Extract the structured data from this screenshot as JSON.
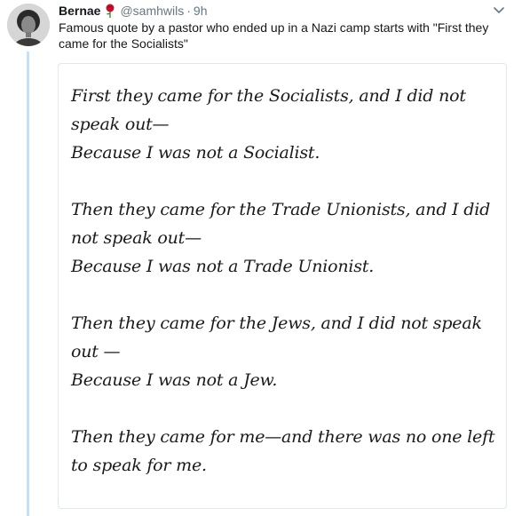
{
  "tweet": {
    "display_name": "Bernae",
    "handle": "@samhwils",
    "separator": "·",
    "time": "9h",
    "text": "Famous quote by a pastor who ended up in a Nazi camp starts with \"First they came for the Socialists\""
  },
  "icons": {
    "name_emoji": "rose-icon",
    "menu": "chevron-down-icon",
    "avatar": "avatar-photo"
  },
  "colors": {
    "thread_line": "#c4dff6",
    "secondary_text": "#657786",
    "card_border": "#e1e8ed"
  },
  "quote": {
    "stanzas": [
      {
        "lines": [
          "First they came for the Socialists, and I did not speak out—",
          "Because I was not a Socialist."
        ]
      },
      {
        "lines": [
          "Then they came for the Trade Unionists, and I did not speak out—",
          "Because I was not a Trade Unionist."
        ]
      },
      {
        "lines": [
          "Then they came for the Jews, and I did not speak out —",
          "Because I was not a Jew."
        ]
      },
      {
        "lines": [
          "Then they came for me—and there was no one left to speak for me."
        ]
      }
    ]
  }
}
